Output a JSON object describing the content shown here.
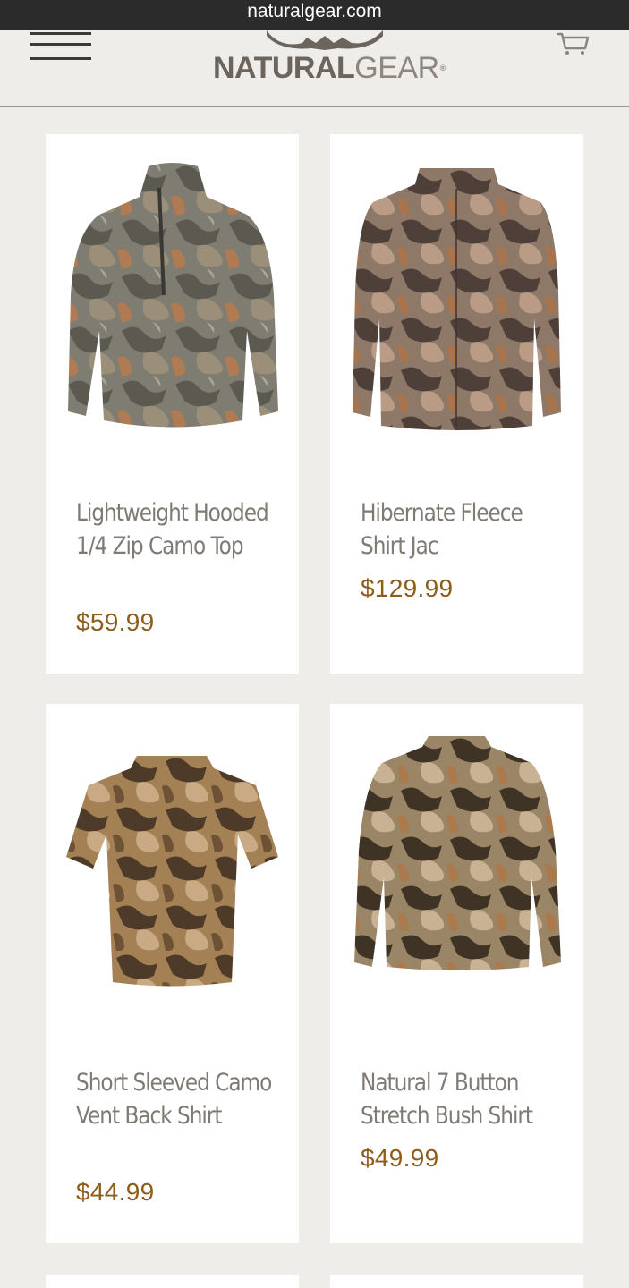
{
  "browser": {
    "url": "naturalgear.com"
  },
  "header": {
    "logo_primary": "NATURAL",
    "logo_secondary": "GEAR",
    "logo_mark": "®"
  },
  "colors": {
    "background": "#eeedea",
    "product_name": "#807a74",
    "price": "#8b5e1e",
    "url_bar": "#2b2b2b"
  },
  "products": [
    {
      "name": "Lightweight Hooded 1/4 Zip Camo Top",
      "price": "$59.99",
      "image": "camo-hooded-quarter-zip-icon"
    },
    {
      "name": "Hibernate Fleece Shirt Jac",
      "price": "$129.99",
      "image": "camo-fleece-shirt-jac-icon"
    },
    {
      "name": "Short Sleeved Camo Vent Back Shirt",
      "price": "$44.99",
      "image": "camo-short-sleeve-shirt-icon"
    },
    {
      "name": "Natural 7 Button Stretch Bush Shirt",
      "price": "$49.99",
      "image": "camo-bush-shirt-icon"
    }
  ]
}
